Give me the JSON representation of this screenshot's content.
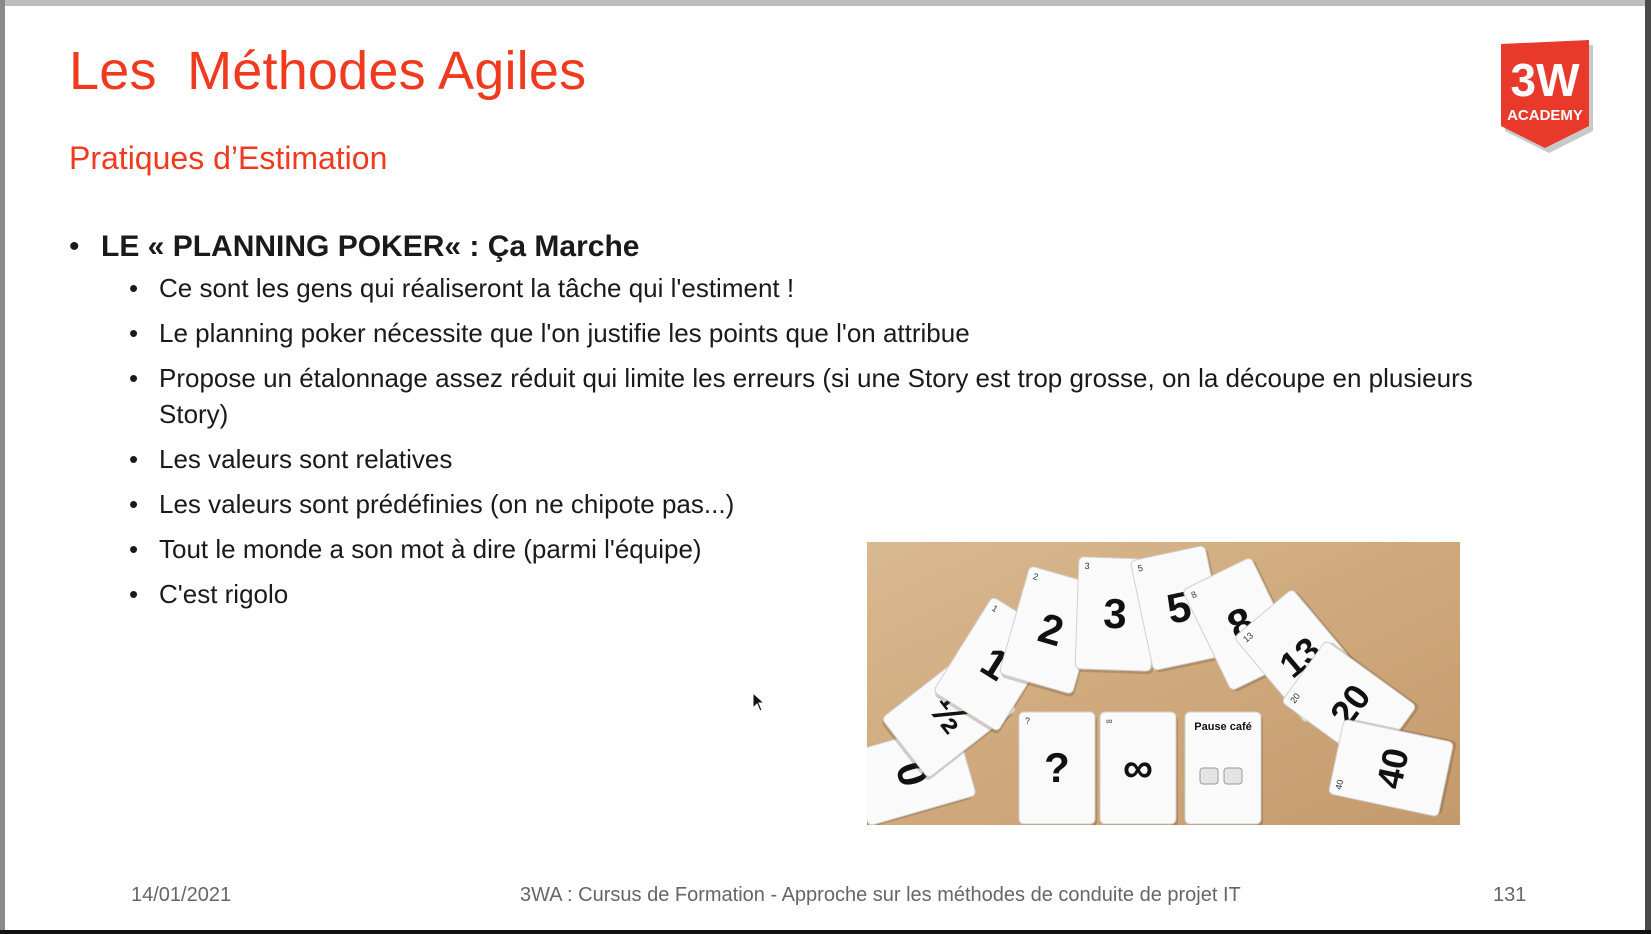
{
  "slide": {
    "title": "Les  Méthodes Agiles",
    "subtitle": "Pratiques d’Estimation",
    "logo": {
      "line1": "3W",
      "line2": "ACADEMY",
      "color": "#e8392b"
    },
    "main_bullet": "LE « PLANNING POKER«  : Ça Marche",
    "sub_bullets": [
      "Ce sont les gens qui réaliseront la tâche qui l'estiment !",
      "Le planning poker nécessite que l'on justifie les points que l'on attribue",
      "Propose un étalonnage assez réduit qui limite les erreurs (si une Story est trop grosse, on la découpe en plusieurs Story)",
      "Les valeurs sont relatives",
      "Les valeurs sont prédéfinies (on ne chipote pas...)",
      "Tout le monde a son mot à dire (parmi l'équipe)",
      "C'est rigolo"
    ],
    "photo": {
      "cards": [
        "0",
        "½",
        "1",
        "2",
        "3",
        "5",
        "8",
        "13",
        "20",
        "40",
        "?",
        "∞",
        "Pause café"
      ]
    },
    "footer": {
      "date": "14/01/2021",
      "center": "3WA : Cursus de Formation - Approche sur les méthodes de conduite de projet IT",
      "page": "131"
    }
  },
  "colors": {
    "accent": "#f03a1f",
    "text": "#1a1a1a",
    "footer": "#666666",
    "table": "#d4b28a"
  },
  "icons": {
    "cursor": "mouse-pointer-icon",
    "bullet": "bullet-dot"
  }
}
